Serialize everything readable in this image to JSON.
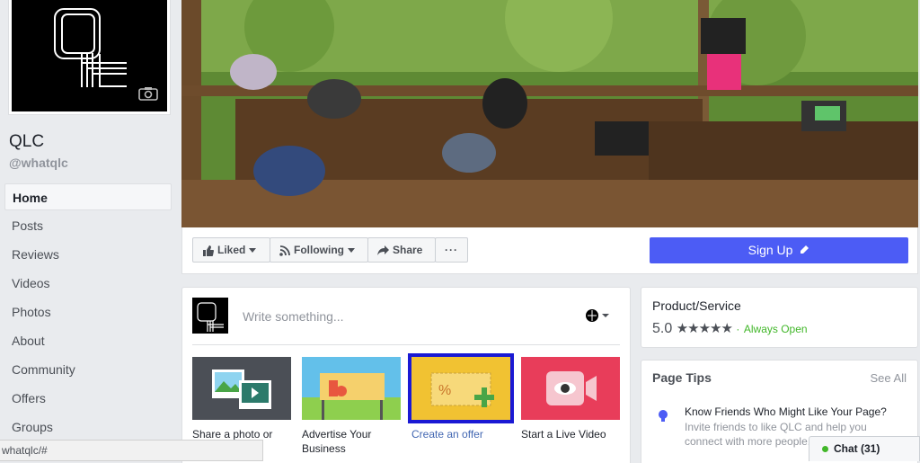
{
  "page": {
    "name": "QLC",
    "handle": "@whatqlc"
  },
  "icons": {
    "camera": "camera-icon",
    "like": "thumbs-up-icon",
    "following": "rss-icon",
    "share": "share-arrow-icon",
    "more": "more-dots-icon",
    "edit": "pencil-icon",
    "globe": "globe-icon",
    "bulb": "lightbulb-icon"
  },
  "nav": {
    "items": [
      {
        "label": "Home"
      },
      {
        "label": "Posts"
      },
      {
        "label": "Reviews"
      },
      {
        "label": "Videos"
      },
      {
        "label": "Photos"
      },
      {
        "label": "About"
      },
      {
        "label": "Community"
      },
      {
        "label": "Offers"
      },
      {
        "label": "Groups"
      }
    ]
  },
  "actions": {
    "liked": "Liked",
    "following": "Following",
    "share": "Share",
    "more": "···",
    "signup": "Sign Up"
  },
  "composer": {
    "placeholder": "Write something...",
    "tiles": [
      {
        "label": "Share a photo or"
      },
      {
        "label": "Advertise Your Business"
      },
      {
        "label": "Create an offer"
      },
      {
        "label": "Start a Live Video"
      }
    ]
  },
  "about": {
    "category": "Product/Service",
    "rating": "5.0",
    "stars": "★★★★★",
    "separator": "·",
    "hours": "Always Open"
  },
  "tips": {
    "title": "Page Tips",
    "see_all": "See All",
    "head": "Know Friends Who Might Like Your Page?",
    "body": "Invite friends to like QLC and help you connect with more people."
  },
  "status": {
    "url": "whatqlc/#"
  },
  "chat": {
    "label": "Chat (31)"
  },
  "colors": {
    "signup": "#4c5cf5",
    "open_green": "#42b72a",
    "selected_outline": "#1a19d4",
    "link_blue": "#4267b2"
  }
}
